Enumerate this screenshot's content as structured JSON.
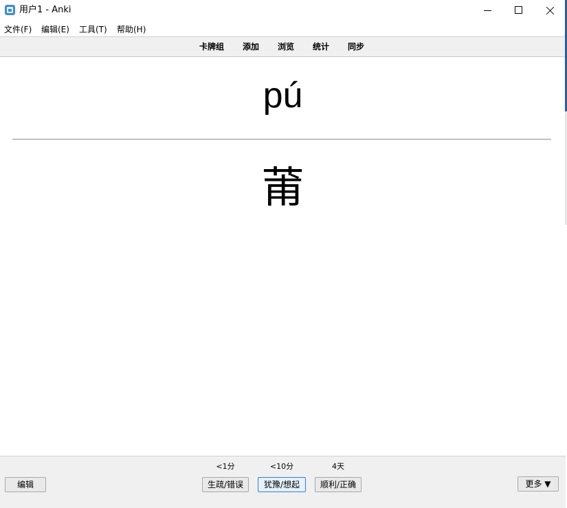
{
  "window": {
    "title": "用户1 - Anki"
  },
  "menu": {
    "file": "文件(F)",
    "edit": "编辑(E)",
    "tools": "工具(T)",
    "help": "帮助(H)"
  },
  "toolbar": {
    "decks": "卡牌组",
    "add": "添加",
    "browse": "浏览",
    "stats": "统计",
    "sync": "同步"
  },
  "card": {
    "front": "pú",
    "back": "莆"
  },
  "bottom": {
    "edit_label": "编辑",
    "again_interval": "<1分",
    "again_label": "生疏/错误",
    "hard_interval": "<10分",
    "hard_label": "犹豫/想起",
    "good_interval": "4天",
    "good_label": "顺利/正确",
    "more_label": "更多 ▼"
  },
  "colors": {
    "toolbar_bg": "#f0f0f0",
    "focus_border": "#3a7bd5",
    "app_icon": "#3d8bd9"
  },
  "icons": {
    "app": "anki-app-icon",
    "minimize": "minimize-icon",
    "maximize": "maximize-icon",
    "close": "close-icon"
  }
}
